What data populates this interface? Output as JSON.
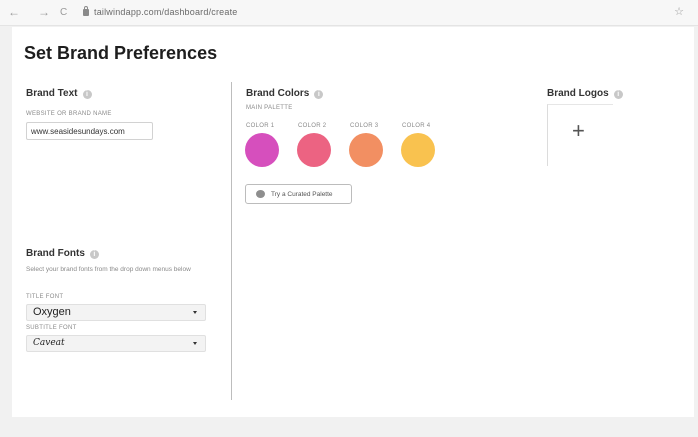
{
  "browser": {
    "back": "←",
    "forward": "→",
    "reload": "C",
    "url": "tailwindapp.com/dashboard/create",
    "star": "☆"
  },
  "page": {
    "title": "Set Brand Preferences"
  },
  "brand_text": {
    "title": "Brand Text",
    "info": "i",
    "website_label": "WEBSITE OR BRAND NAME",
    "website_value": "www.seasidesundays.com"
  },
  "brand_fonts": {
    "title": "Brand Fonts",
    "info": "i",
    "description": "Select your brand fonts from the drop down menus below",
    "title_font_label": "TITLE FONT",
    "title_font_value": "Oxygen",
    "subtitle_font_label": "SUBTITLE FONT",
    "subtitle_font_value": "Caveat"
  },
  "brand_colors": {
    "title": "Brand Colors",
    "info": "i",
    "palette_label": "MAIN PALETTE",
    "colors": [
      {
        "label": "COLOR 1",
        "hex": "#d64fbd"
      },
      {
        "label": "COLOR 2",
        "hex": "#ec6382"
      },
      {
        "label": "COLOR 3",
        "hex": "#f28f62"
      },
      {
        "label": "COLOR 4",
        "hex": "#f9c24f"
      }
    ],
    "curated_button": "Try a Curated Palette"
  },
  "brand_logos": {
    "title": "Brand Logos",
    "info": "i",
    "add": "+"
  }
}
